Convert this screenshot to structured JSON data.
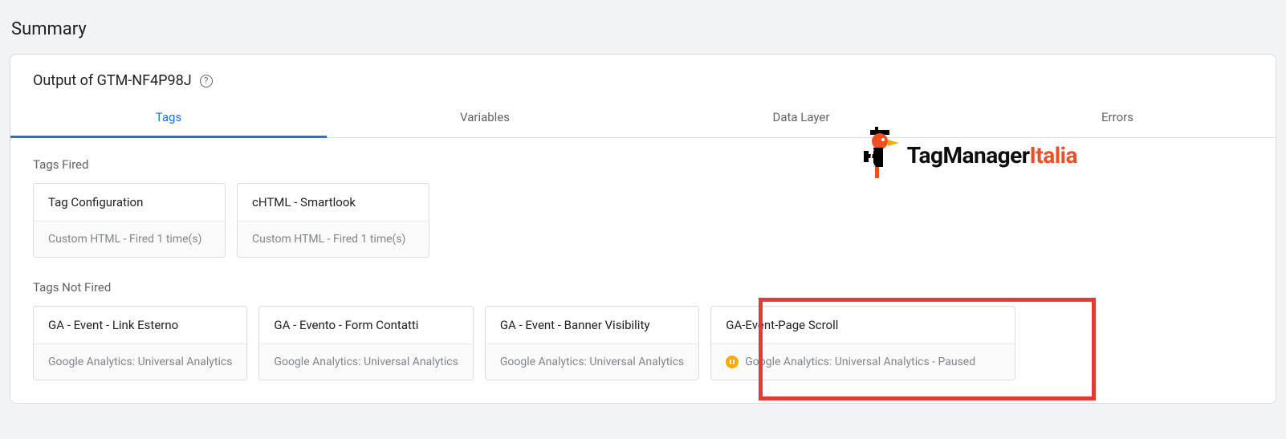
{
  "page_title": "Summary",
  "card_title": "Output of GTM-NF4P98J",
  "tabs": [
    {
      "label": "Tags",
      "active": true
    },
    {
      "label": "Variables",
      "active": false
    },
    {
      "label": "Data Layer",
      "active": false
    },
    {
      "label": "Errors",
      "active": false
    }
  ],
  "sections": {
    "fired_label": "Tags Fired",
    "not_fired_label": "Tags Not Fired"
  },
  "fired_tags": [
    {
      "title": "Tag Configuration",
      "subtitle": "Custom HTML - Fired 1 time(s)"
    },
    {
      "title": "cHTML - Smartlook",
      "subtitle": "Custom HTML - Fired 1 time(s)"
    }
  ],
  "not_fired_tags": [
    {
      "title": "GA - Event - Link Esterno",
      "subtitle": "Google Analytics: Universal Analytics",
      "paused": false
    },
    {
      "title": "GA - Evento - Form Contatti",
      "subtitle": "Google Analytics: Universal Analytics",
      "paused": false
    },
    {
      "title": "GA - Event - Banner Visibility",
      "subtitle": "Google Analytics: Universal Analytics",
      "paused": false
    },
    {
      "title": "GA-Event-Page Scroll",
      "subtitle": "Google Analytics: Universal Analytics - Paused",
      "paused": true
    }
  ],
  "logo": {
    "text1": "TagManager",
    "text2": "Italia"
  }
}
